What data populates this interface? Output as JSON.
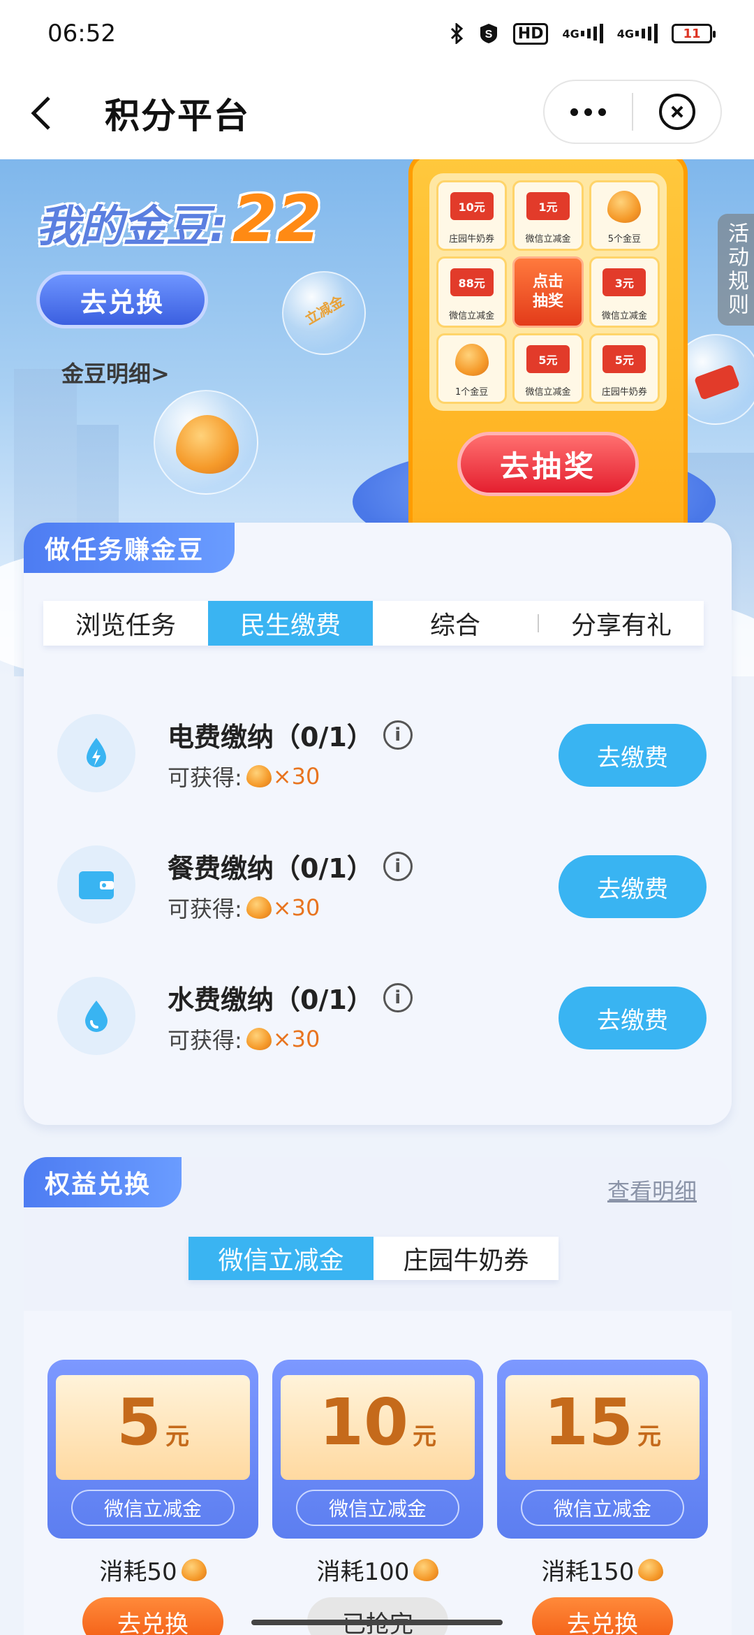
{
  "status_bar": {
    "time": "06:52",
    "icons": [
      "bluetooth-icon",
      "s-app-icon",
      "hd-icon",
      "signal-4g-icon",
      "signal-4g-icon",
      "battery-icon"
    ],
    "hd_label": "HD",
    "net1": "4G",
    "net2": "4G",
    "battery": "11",
    "battery_color": "#dd3322"
  },
  "nav": {
    "title": "积分平台"
  },
  "hero": {
    "label": "我的金豆:",
    "bean_count": "22",
    "exchange_label": "去兑换",
    "detail_link": "金豆明细>",
    "draw_label": "去抽奖",
    "rules_label": "活动规则",
    "sticker_text": "立减金",
    "prizes": [
      {
        "badge": "10元",
        "name": "庄园牛奶券",
        "kind": "ticket"
      },
      {
        "badge": "1元",
        "name": "微信立减金",
        "kind": "ticket"
      },
      {
        "badge": "",
        "name": "5个金豆",
        "kind": "bean"
      },
      {
        "badge": "88元",
        "name": "微信立减金",
        "kind": "ticket"
      },
      {
        "badge": "",
        "name": "点击抽奖",
        "kind": "center"
      },
      {
        "badge": "3元",
        "name": "微信立减金",
        "kind": "ticket"
      },
      {
        "badge": "",
        "name": "1个金豆",
        "kind": "bean"
      },
      {
        "badge": "5元",
        "name": "微信立减金",
        "kind": "ticket"
      },
      {
        "badge": "5元",
        "name": "庄园牛奶券",
        "kind": "ticket"
      }
    ]
  },
  "tasks": {
    "section_title": "做任务赚金豆",
    "tabs": [
      {
        "label": "浏览任务",
        "active": false
      },
      {
        "label": "民生缴费",
        "active": true
      },
      {
        "label": "综合",
        "active": false
      },
      {
        "label": "分享有礼",
        "active": false
      }
    ],
    "items": [
      {
        "name": "电费缴纳（0/1）",
        "reward_label": "可获得:",
        "reward_amount": "×30",
        "button": "去缴费",
        "icon": "lightning-drop-icon"
      },
      {
        "name": "餐费缴纳（0/1）",
        "reward_label": "可获得:",
        "reward_amount": "×30",
        "button": "去缴费",
        "icon": "wallet-icon"
      },
      {
        "name": "水费缴纳（0/1）",
        "reward_label": "可获得:",
        "reward_amount": "×30",
        "button": "去缴费",
        "icon": "water-drop-icon"
      }
    ],
    "info_glyph": "i"
  },
  "rights": {
    "section_title": "权益兑换",
    "view_detail": "查看明细",
    "tabs": [
      {
        "label": "微信立减金",
        "active": true
      },
      {
        "label": "庄园牛奶券",
        "active": false
      }
    ],
    "coupons": [
      {
        "value": "5",
        "unit": "元",
        "name": "微信立减金",
        "cost": "消耗50",
        "button": "去兑换",
        "available": true
      },
      {
        "value": "10",
        "unit": "元",
        "name": "微信立减金",
        "cost": "消耗100",
        "button": "已抢完",
        "available": false
      },
      {
        "value": "15",
        "unit": "元",
        "name": "微信立减金",
        "cost": "消耗150",
        "button": "去兑换",
        "available": true
      }
    ]
  },
  "colors": {
    "accent_blue": "#3ab4f2",
    "tag_blue": "#4d7cf2",
    "bean_orange": "#ff8a14",
    "exchange_orange": "#f25a12",
    "draw_red": "#e41f2f"
  }
}
